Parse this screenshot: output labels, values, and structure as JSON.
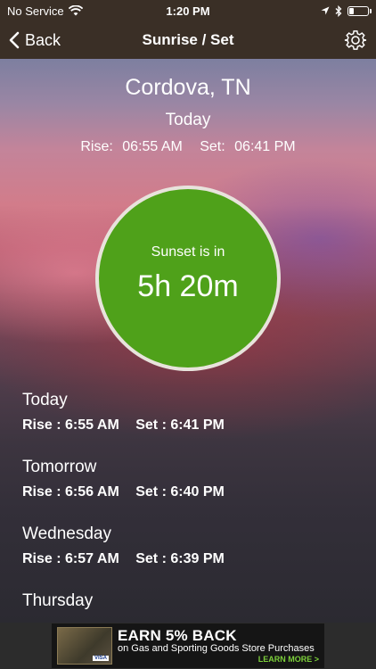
{
  "status_bar": {
    "carrier": "No Service",
    "time": "1:20 PM"
  },
  "navbar": {
    "back_label": "Back",
    "title": "Sunrise / Set"
  },
  "location": {
    "city": "Cordova, TN",
    "day": "Today",
    "rise_label": "Rise:",
    "rise_time": "06:55 AM",
    "set_label": "Set:",
    "set_time": "06:41 PM"
  },
  "countdown": {
    "label": "Sunset is in",
    "value": "5h 20m",
    "color": "#4fa11a"
  },
  "forecast": [
    {
      "day": "Today",
      "rise": "Rise : 6:55 AM",
      "set": "Set : 6:41 PM"
    },
    {
      "day": "Tomorrow",
      "rise": "Rise : 6:56 AM",
      "set": "Set : 6:40 PM"
    },
    {
      "day": "Wednesday",
      "rise": "Rise : 6:57 AM",
      "set": "Set : 6:39 PM"
    },
    {
      "day": "Thursday",
      "rise": "",
      "set": ""
    }
  ],
  "ad": {
    "headline": "EARN 5% BACK",
    "subline": "on Gas and Sporting Goods Store Purchases",
    "cta": "LEARN MORE >",
    "card_brand": "VISA"
  },
  "icons": {
    "wifi": "wifi-icon",
    "location": "location-arrow-icon",
    "bluetooth": "bluetooth-icon",
    "battery": "battery-icon",
    "back": "chevron-left-icon",
    "settings": "gear-icon"
  }
}
